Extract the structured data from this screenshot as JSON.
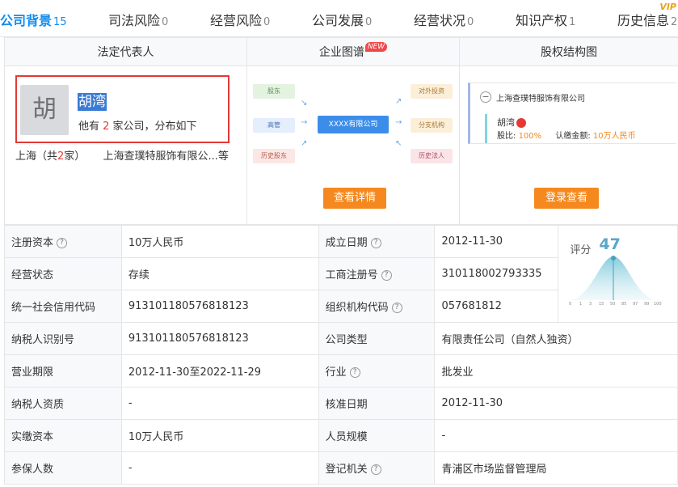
{
  "tabs": [
    {
      "name": "公司背景",
      "count": "15",
      "active": true
    },
    {
      "name": "司法风险",
      "count": "0"
    },
    {
      "name": "经营风险",
      "count": "0"
    },
    {
      "name": "公司发展",
      "count": "0"
    },
    {
      "name": "经营状况",
      "count": "0"
    },
    {
      "name": "知识产权",
      "count": "1"
    },
    {
      "name": "历史信息",
      "count": "2"
    }
  ],
  "vip_mark": "VIP",
  "legal_rep": {
    "title": "法定代表人",
    "avatar_char": "胡",
    "name": "胡湾",
    "desc_prefix": "他有 ",
    "company_count": "2",
    "desc_suffix": " 家公司，分布如下",
    "region_prefix": "上海（共",
    "region_count": "2",
    "region_suffix": "家）",
    "company_line": "上海查璞特服饰有限公...等"
  },
  "graph": {
    "title": "企业图谱",
    "new_badge": "NEW",
    "nodes": {
      "shareholder": "股东",
      "executive": "高管",
      "history_shareholder": "历史股东",
      "center": "XXXX有限公司",
      "investment": "对外投资",
      "branch": "分支机构",
      "history_legal": "历史法人"
    },
    "button": "查看详情"
  },
  "equity": {
    "title": "股权结构图",
    "company": "上海查璞特服饰有限公司",
    "person": "胡湾",
    "ratio_label": "股比: ",
    "ratio": "100%",
    "capital_label": "认缴金额: ",
    "capital": "10万人民币",
    "button": "登录查看"
  },
  "info_rows": [
    {
      "l1": "注册资本",
      "q1": true,
      "v1": "10万人民币",
      "l2": "成立日期",
      "q2": true,
      "v2": "2012-11-30"
    },
    {
      "l1": "经营状态",
      "v1": "存续",
      "l2": "工商注册号",
      "q2": true,
      "v2": "310118002793335"
    },
    {
      "l1": "统一社会信用代码",
      "v1": "913101180576818123",
      "l2": "组织机构代码",
      "q2": true,
      "v2": "057681812"
    },
    {
      "l1": "纳税人识别号",
      "v1": "913101180576818123",
      "l2": "公司类型",
      "v2": "有限责任公司（自然人独资）"
    },
    {
      "l1": "营业期限",
      "v1": "2012-11-30至2022-11-29",
      "l2": "行业",
      "q2": true,
      "v2": "批发业"
    },
    {
      "l1": "纳税人资质",
      "v1": "-",
      "l2": "核准日期",
      "v2": "2012-11-30"
    },
    {
      "l1": "实缴资本",
      "v1": "10万人民币",
      "l2": "人员规模",
      "v2": "-"
    },
    {
      "l1": "参保人数",
      "v1": "-",
      "l2": "登记机关",
      "q2": true,
      "v2": "青浦区市场监督管理局"
    }
  ],
  "score": {
    "label": "评分",
    "value": "47",
    "axis_ticks": [
      "0",
      "1",
      "3",
      "15",
      "50",
      "85",
      "97",
      "99",
      "100"
    ]
  },
  "help_glyph": "?",
  "minus_glyph": "−",
  "colors": {
    "accent": "#128bed",
    "orange": "#f5891f",
    "red": "#e53935"
  }
}
